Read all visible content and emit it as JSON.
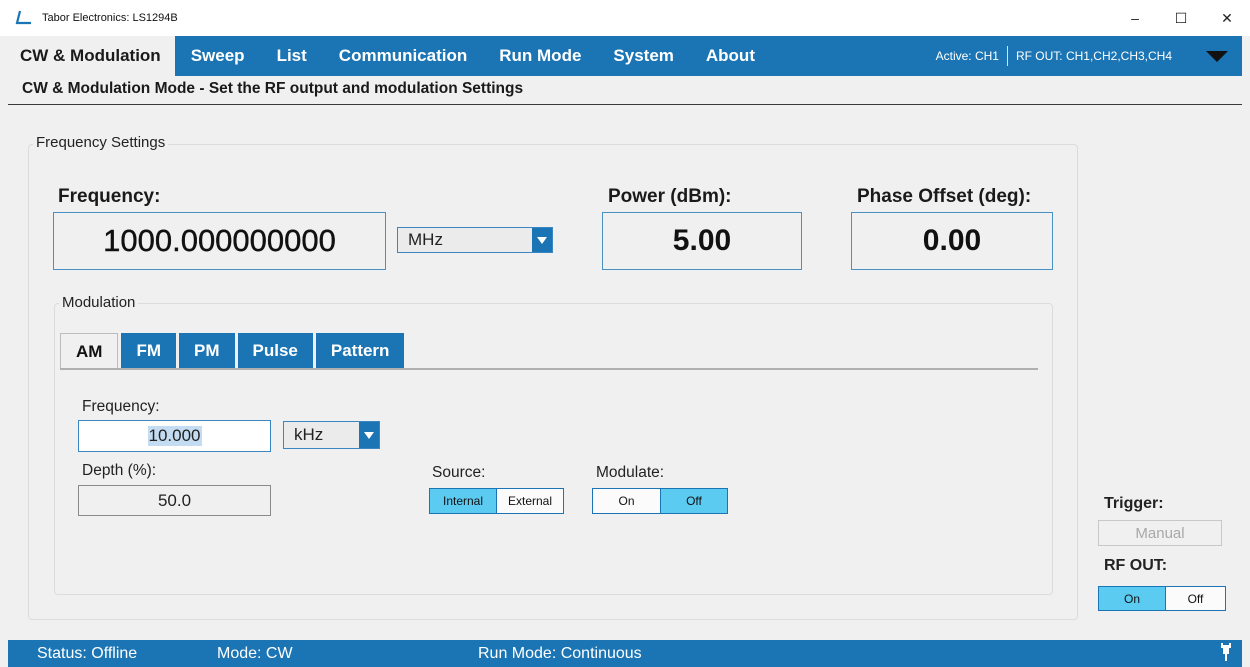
{
  "window": {
    "title": "Tabor Electronics: LS1294B",
    "minimize": "–",
    "maximize": "☐",
    "close": "✕"
  },
  "menu": {
    "items": [
      {
        "label": "CW & Modulation"
      },
      {
        "label": "Sweep"
      },
      {
        "label": "List"
      },
      {
        "label": "Communication"
      },
      {
        "label": "Run Mode"
      },
      {
        "label": "System"
      },
      {
        "label": "About"
      }
    ],
    "active_channel": "Active:  CH1",
    "rf_out": "RF OUT:  CH1,CH2,CH3,CH4"
  },
  "subtitle": "CW & Modulation Mode - Set the RF output and modulation Settings",
  "frequency_settings": {
    "group_label": "Frequency Settings",
    "frequency_label": "Frequency:",
    "frequency_value": "1000.000000000",
    "frequency_unit": "MHz",
    "power_label": "Power (dBm):",
    "power_value": "5.00",
    "phase_label": "Phase Offset (deg):",
    "phase_value": "0.00"
  },
  "modulation": {
    "group_label": "Modulation",
    "tabs": [
      {
        "label": "AM"
      },
      {
        "label": "FM"
      },
      {
        "label": "PM"
      },
      {
        "label": "Pulse"
      },
      {
        "label": "Pattern"
      }
    ],
    "frequency_label": "Frequency:",
    "frequency_value": "10.000",
    "frequency_unit": "kHz",
    "depth_label": "Depth (%):",
    "depth_value": "50.0",
    "source_label": "Source:",
    "source_options": [
      "Internal",
      "External"
    ],
    "source_selected": "Internal",
    "modulate_label": "Modulate:",
    "modulate_options": [
      "On",
      "Off"
    ],
    "modulate_selected": "Off"
  },
  "trigger": {
    "label": "Trigger:",
    "button": "Manual"
  },
  "rf_out": {
    "label": "RF OUT:",
    "options": [
      "On",
      "Off"
    ],
    "selected": "On"
  },
  "status": {
    "status": "Status: Offline",
    "mode": "Mode: CW",
    "run_mode": "Run Mode: Continuous"
  },
  "colors": {
    "accent": "#1b75b4",
    "toggle_on": "#5ccbf2"
  },
  "icons": [
    "app-logo-icon",
    "dropdown-arrow-icon",
    "chevron-down-icon",
    "connection-plug-icon"
  ]
}
